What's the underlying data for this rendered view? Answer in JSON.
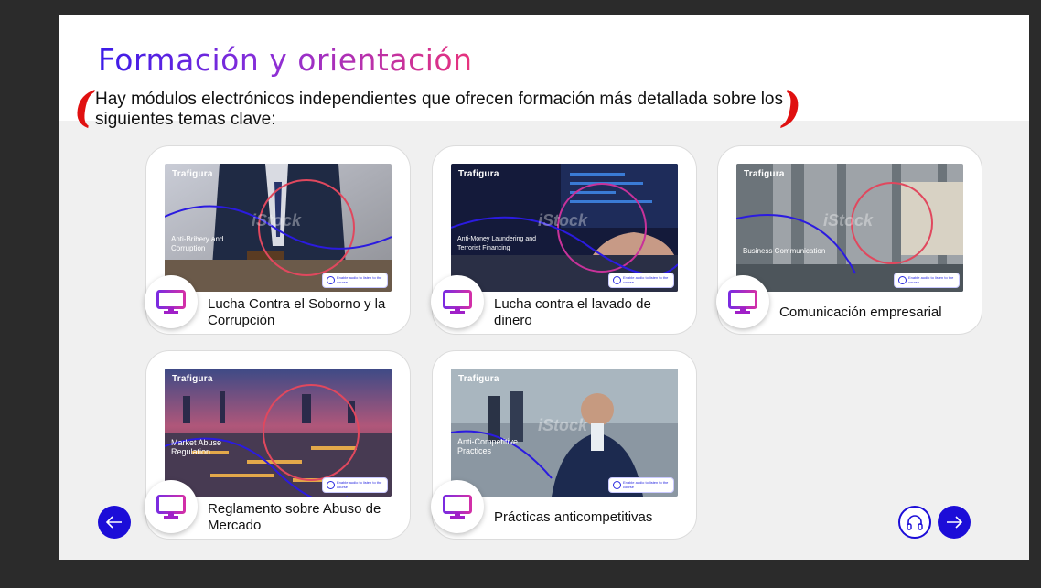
{
  "slide": {
    "title": "Formación y orientación",
    "intro": "Hay módulos electrónicos independientes que ofrecen formación más detallada sobre los siguientes temas clave:"
  },
  "cards": [
    {
      "label": "Lucha Contra el Soborno y la Corrupción",
      "thumb_logo": "Trafigura",
      "thumb_course": "Anti-Bribery and Corruption",
      "watermark": "iStock",
      "audio_note": "Enable audio to listen to the course"
    },
    {
      "label": "Lucha contra el lavado de dinero",
      "thumb_logo": "Trafigura",
      "thumb_course": "Anti-Money Laundering and Terrorist Financing",
      "watermark": "iStock",
      "audio_note": "Enable audio to listen to the course"
    },
    {
      "label": "Comunicación empresarial",
      "thumb_logo": "Trafigura",
      "thumb_course": "Business Communication",
      "watermark": "iStock",
      "audio_note": "Enable audio to listen to the course"
    },
    {
      "label": "Reglamento sobre Abuso de Mercado",
      "thumb_logo": "Trafigura",
      "thumb_course": "Market Abuse Regulation",
      "watermark": "iStock",
      "audio_note": "Enable audio to listen to the course"
    },
    {
      "label": "Prácticas anticompetitivas",
      "thumb_logo": "Trafigura",
      "thumb_course": "Anti-Competitive Practices",
      "watermark": "iStock",
      "audio_note": "Enable audio to listen to the course"
    }
  ],
  "icons": {
    "card_icon": "monitor-icon",
    "prev": "arrow-left-icon",
    "next": "arrow-right-icon",
    "audio": "headphones-icon"
  },
  "colors": {
    "accent_blue": "#1c0dd8",
    "title_gradient_start": "#3a1be8",
    "title_gradient_end": "#e8337c",
    "annotation_red": "#e01010",
    "monitor_icon": "#a020c8"
  }
}
